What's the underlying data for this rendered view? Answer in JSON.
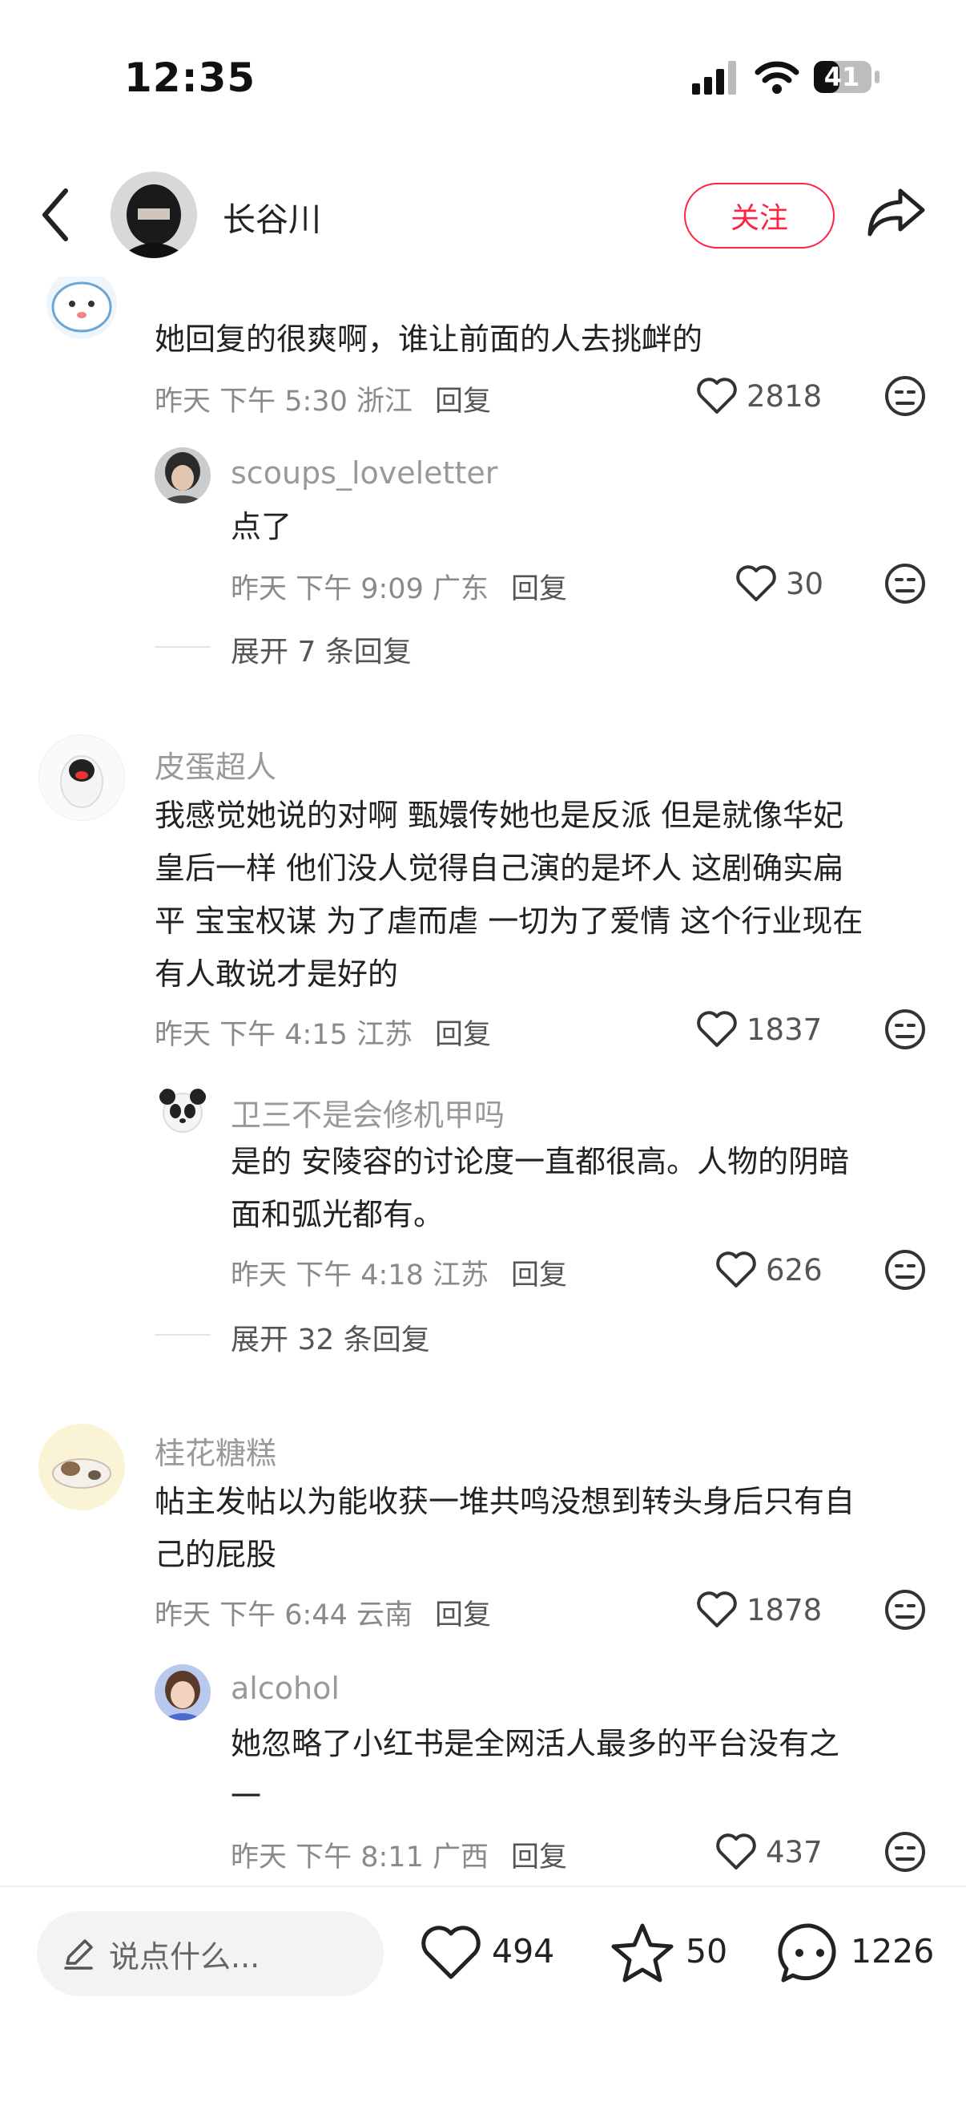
{
  "status_bar": {
    "time": "12:35",
    "battery": "41"
  },
  "header": {
    "username": "长谷川",
    "follow_label": "关注"
  },
  "comments": [
    {
      "text": "她回复的很爽啊，谁让前面的人去挑衅的",
      "time": "昨天 下午 5:30 浙江",
      "reply": "回复",
      "likes": "2818",
      "replies": [
        {
          "username": "scoups_loveletter",
          "text": "点了",
          "time": "昨天 下午 9:09 广东",
          "reply": "回复",
          "likes": "30"
        }
      ],
      "expand": "展开 7 条回复"
    },
    {
      "username": "皮蛋超人",
      "text_lines": [
        "我感觉她说的对啊 甄嬛传她也是反派 但是就像华妃",
        "皇后一样 他们没人觉得自己演的是坏人 这剧确实扁",
        "平 宝宝权谋 为了虐而虐 一切为了爱情 这个行业现在",
        "有人敢说才是好的"
      ],
      "time": "昨天 下午 4:15 江苏",
      "reply": "回复",
      "likes": "1837",
      "replies": [
        {
          "username": "卫三不是会修机甲吗",
          "text_lines": [
            "是的 安陵容的讨论度一直都很高。人物的阴暗",
            "面和弧光都有。"
          ],
          "time": "昨天 下午 4:18 江苏",
          "reply": "回复",
          "likes": "626"
        }
      ],
      "expand": "展开 32 条回复"
    },
    {
      "username": "桂花糖糕",
      "text_lines": [
        "帖主发帖以为能收获一堆共鸣没想到转头身后只有自",
        "己的屁股"
      ],
      "time": "昨天 下午 6:44 云南",
      "reply": "回复",
      "likes": "1878",
      "replies": [
        {
          "username": "alcohol",
          "text_lines": [
            "她忽略了小红书是全网活人最多的平台没有之",
            "一"
          ],
          "time": "昨天 下午 8:11 广西",
          "reply": "回复",
          "likes": "437"
        }
      ]
    }
  ],
  "bottom_bar": {
    "input_placeholder": "说点什么...",
    "likes": "494",
    "favorites": "50",
    "comments": "1226"
  },
  "colors": {
    "accent": "#ff2442",
    "meta": "#8a8a8a",
    "username": "#999999"
  }
}
